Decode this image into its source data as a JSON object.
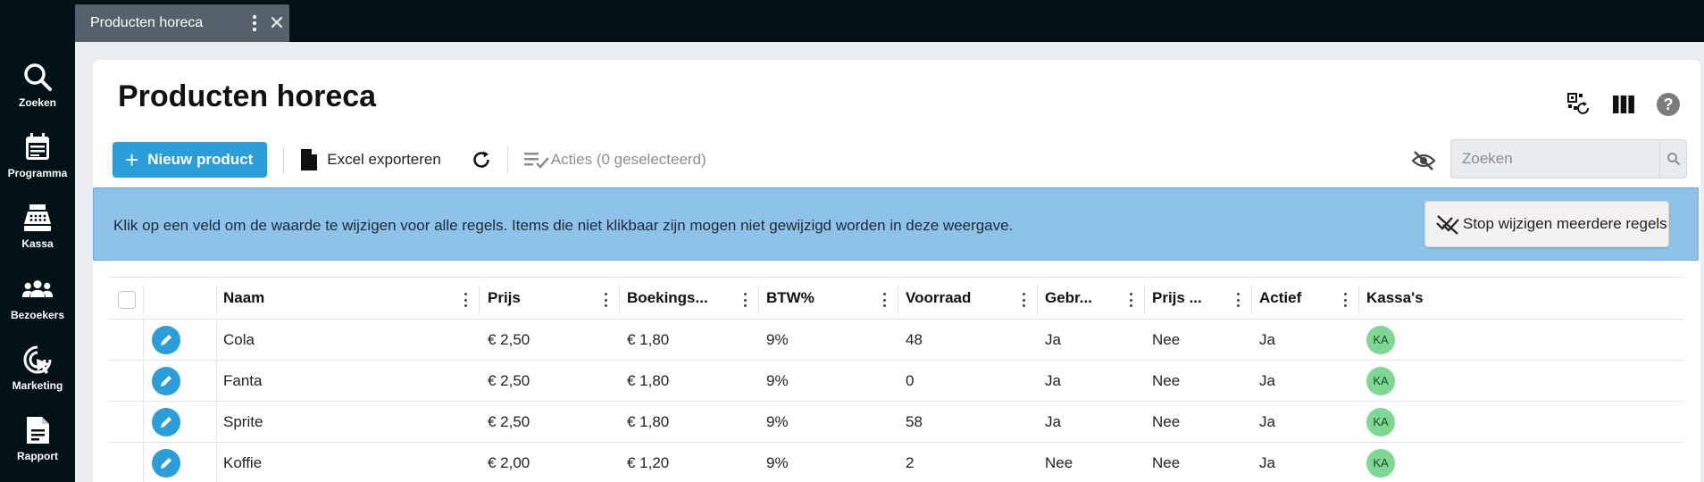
{
  "sidebar": {
    "items": [
      {
        "label": "Zoeken",
        "icon": "search-icon"
      },
      {
        "label": "Programma",
        "icon": "calendar-icon"
      },
      {
        "label": "Kassa",
        "icon": "cash-register-icon"
      },
      {
        "label": "Bezoekers",
        "icon": "people-icon"
      },
      {
        "label": "Marketing",
        "icon": "target-cursor-icon"
      },
      {
        "label": "Rapport",
        "icon": "report-icon"
      }
    ]
  },
  "tab": {
    "title": "Producten horeca"
  },
  "page": {
    "title": "Producten horeca"
  },
  "toolbar": {
    "new_label": "Nieuw product",
    "export_label": "Excel exporteren",
    "actions_label": "Acties (0 geselecteerd)"
  },
  "search": {
    "placeholder": "Zoeken"
  },
  "banner": {
    "message": "Klik op een veld om de waarde te wijzigen voor alle regels. Items die niet klikbaar zijn mogen niet gewijzigd worden in deze weergave.",
    "stop_label": "Stop wijzigen meerdere regels"
  },
  "table": {
    "headers": [
      "Naam",
      "Prijs",
      "Boekings...",
      "BTW%",
      "Voorraad",
      "Gebr...",
      "Prijs ...",
      "Actief",
      "Kassa's"
    ],
    "rows": [
      [
        "Cola",
        "€ 2,50",
        "€ 1,80",
        "9%",
        "48",
        "Ja",
        "Nee",
        "Ja",
        "KA"
      ],
      [
        "Fanta",
        "€ 2,50",
        "€ 1,80",
        "9%",
        "0",
        "Ja",
        "Nee",
        "Ja",
        "KA"
      ],
      [
        "Sprite",
        "€ 2,50",
        "€ 1,80",
        "9%",
        "58",
        "Ja",
        "Nee",
        "Ja",
        "KA"
      ],
      [
        "Koffie",
        "€ 2,00",
        "€ 1,20",
        "9%",
        "2",
        "Nee",
        "Nee",
        "Ja",
        "KA"
      ]
    ]
  },
  "colors": {
    "accent": "#2b9ed9",
    "banner": "#8ec2e9",
    "badge": "#7ed893",
    "sidebar": "#031219"
  }
}
